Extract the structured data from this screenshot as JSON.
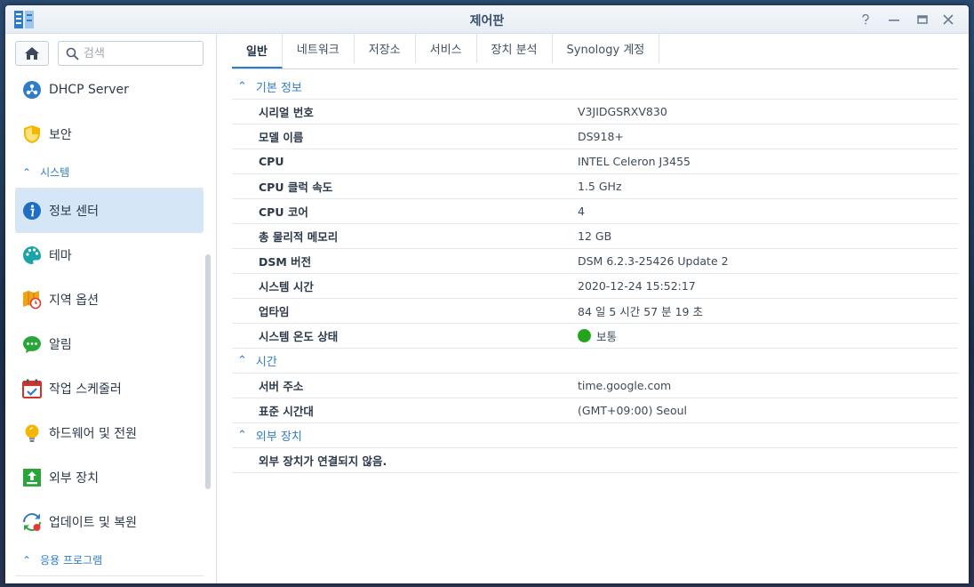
{
  "window": {
    "title": "제어판"
  },
  "search": {
    "placeholder": "검색"
  },
  "sidebar": {
    "items_top": [
      {
        "label": "DHCP Server",
        "icon": "dhcp-icon"
      },
      {
        "label": "보안",
        "icon": "security-shield-icon"
      }
    ],
    "section_system": "시스템",
    "items_system": [
      {
        "label": "정보 센터",
        "icon": "info-center-icon",
        "active": true
      },
      {
        "label": "테마",
        "icon": "theme-palette-icon"
      },
      {
        "label": "지역 옵션",
        "icon": "regional-options-icon"
      },
      {
        "label": "알림",
        "icon": "notification-icon"
      },
      {
        "label": "작업 스케줄러",
        "icon": "task-scheduler-icon"
      },
      {
        "label": "하드웨어 및 전원",
        "icon": "hardware-power-icon"
      },
      {
        "label": "외부 장치",
        "icon": "external-devices-icon"
      },
      {
        "label": "업데이트 및 복원",
        "icon": "update-restore-icon"
      }
    ],
    "section_apps": "응용 프로그램"
  },
  "tabs": [
    "일반",
    "네트워크",
    "저장소",
    "서비스",
    "장치 분석",
    "Synology 계정"
  ],
  "groups": {
    "basic": {
      "title": "기본 정보",
      "rows": [
        {
          "key": "시리얼 번호",
          "value": "V3JIDGSRXV830"
        },
        {
          "key": "모델 이름",
          "value": "DS918+"
        },
        {
          "key": "CPU",
          "value": "INTEL Celeron J3455"
        },
        {
          "key": "CPU 클럭 속도",
          "value": "1.5 GHz"
        },
        {
          "key": "CPU 코어",
          "value": "4"
        },
        {
          "key": "총 물리적 메모리",
          "value": "12 GB"
        },
        {
          "key": "DSM 버전",
          "value": "DSM 6.2.3-25426 Update 2"
        },
        {
          "key": "시스템 시간",
          "value": "2020-12-24 15:52:17"
        },
        {
          "key": "업타임",
          "value": "84 일 5 시간 57 분 19 초"
        },
        {
          "key": "시스템 온도 상태",
          "value": "보통"
        }
      ]
    },
    "time": {
      "title": "시간",
      "rows": [
        {
          "key": "서버 주소",
          "value": "time.google.com"
        },
        {
          "key": "표준 시간대",
          "value": "(GMT+09:00) Seoul"
        }
      ]
    },
    "external": {
      "title": "외부 장치",
      "rows": [
        {
          "key": "외부 장치가 연결되지 않음.",
          "value": ""
        }
      ]
    }
  },
  "colors": {
    "accent": "#2f7dc9",
    "status_ok": "#23a41f",
    "active_bg": "#d5e6f7"
  }
}
